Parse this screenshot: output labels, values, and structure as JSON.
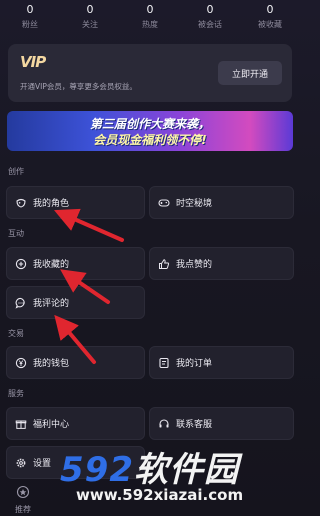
{
  "stats": [
    {
      "num": "0",
      "label": "粉丝"
    },
    {
      "num": "0",
      "label": "关注"
    },
    {
      "num": "0",
      "label": "热度"
    },
    {
      "num": "0",
      "label": "被会话"
    },
    {
      "num": "0",
      "label": "被收藏"
    }
  ],
  "vip": {
    "logo": "VIP",
    "desc": "开通VIP会员，尊享更多会员权益。",
    "button": "立即开通"
  },
  "banner": {
    "line1": "第三届创作大赛来袭，",
    "line2": "会员现金福利领不停!"
  },
  "sections": {
    "create": "创作",
    "interact": "互动",
    "trade": "交易",
    "service": "服务"
  },
  "cards": {
    "my_role": "我的角色",
    "space_secret": "时空秘境",
    "my_favorites": "我收藏的",
    "my_likes": "我点赞的",
    "my_comments": "我评论的",
    "my_wallet": "我的钱包",
    "my_orders": "我的订单",
    "welfare": "福利中心",
    "contact": "联系客服",
    "settings": "设置"
  },
  "bottom_nav": {
    "recommend": "推荐"
  },
  "watermark": {
    "big_num": "592",
    "big_text": "软件园",
    "url": "www.592xiazai.com"
  },
  "colors": {
    "accent_red": "#e0262f",
    "watermark_blue": "#2f6ee6"
  }
}
